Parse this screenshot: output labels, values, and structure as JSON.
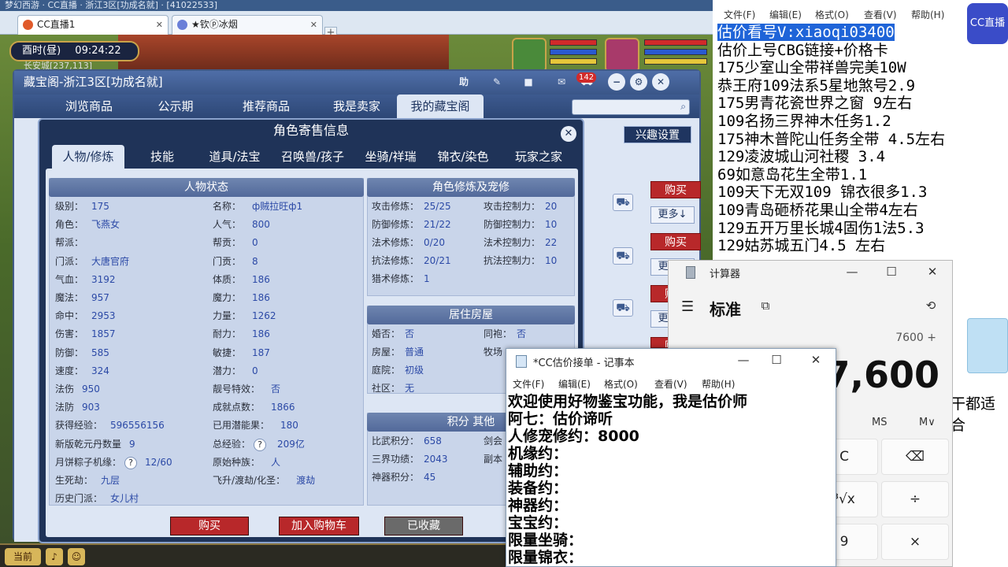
{
  "browser": {
    "tabs": [
      {
        "label": "CC直播1"
      },
      {
        "label": "★钦ⓟ冰烟"
      }
    ]
  },
  "game": {
    "clock_period": "酉时(昼)",
    "clock_time": "09:24:22",
    "location": "长安城[237,113]",
    "bottom_left": "当前"
  },
  "cbg": {
    "title": "藏宝阁-浙江3区[功成名就]",
    "help_label": "助",
    "cart_count": "142",
    "nav": [
      "浏览商品",
      "公示期",
      "推荐商品",
      "我是卖家",
      "我的藏宝阁"
    ],
    "interest_label": "兴趣设置",
    "buy_label": "购买",
    "more_label": "更多↓"
  },
  "dialog": {
    "title": "角色寄售信息",
    "tabs": [
      "人物/修炼",
      "技能",
      "道具/法宝",
      "召唤兽/孩子",
      "坐骑/祥瑞",
      "锦衣/染色",
      "玩家之家"
    ],
    "sections": {
      "person": "人物状态",
      "cultivation": "角色修炼及宠修",
      "house": "居住房屋",
      "points": "积分 其他"
    },
    "person_left": [
      {
        "label": "级别：",
        "value": "175"
      },
      {
        "label": "角色：",
        "value": "飞燕女"
      },
      {
        "label": "帮派：",
        "value": ""
      },
      {
        "label": "门派：",
        "value": "大唐官府"
      },
      {
        "label": "气血：",
        "value": "3192"
      },
      {
        "label": "魔法：",
        "value": "957"
      },
      {
        "label": "命中：",
        "value": "2953"
      },
      {
        "label": "伤害：",
        "value": "1857"
      },
      {
        "label": "防御：",
        "value": "585"
      },
      {
        "label": "速度：",
        "value": "324"
      },
      {
        "label": "法伤",
        "value": "950"
      },
      {
        "label": "法防",
        "value": "903"
      },
      {
        "label": "获得经验：",
        "value": "596556156"
      },
      {
        "label": "新版乾元丹数量",
        "value": "9"
      },
      {
        "label": "月饼粽子机缘：",
        "value": "12/60"
      },
      {
        "label": "生死劫：",
        "value": "九层"
      },
      {
        "label": "历史门派：",
        "value": "女儿村"
      }
    ],
    "person_right": [
      {
        "label": "名称：",
        "value": "ф贼拉旺ф1"
      },
      {
        "label": "人气：",
        "value": "800"
      },
      {
        "label": "帮贡：",
        "value": "0"
      },
      {
        "label": "门贡：",
        "value": "8"
      },
      {
        "label": "体质：",
        "value": "186"
      },
      {
        "label": "魔力：",
        "value": "186"
      },
      {
        "label": "力量：",
        "value": "1262"
      },
      {
        "label": "耐力：",
        "value": "186"
      },
      {
        "label": "敏捷：",
        "value": "187"
      },
      {
        "label": "潜力：",
        "value": "0"
      },
      {
        "label": "靓号特效：",
        "value": "否"
      },
      {
        "label": "成就点数：",
        "value": "1866"
      },
      {
        "label": "已用潜能果：",
        "value": "180"
      },
      {
        "label": "总经验：",
        "value": "209亿"
      },
      {
        "label": "原始种族：",
        "value": "人"
      },
      {
        "label": "飞升/渡劫/化圣：",
        "value": "渡劫"
      }
    ],
    "cultivation": [
      {
        "label": "攻击修炼：",
        "value": "25/25",
        "label2": "攻击控制力：",
        "value2": "20"
      },
      {
        "label": "防御修炼：",
        "value": "21/22",
        "label2": "防御控制力：",
        "value2": "10"
      },
      {
        "label": "法术修炼：",
        "value": "0/20",
        "label2": "法术控制力：",
        "value2": "22"
      },
      {
        "label": "抗法修炼：",
        "value": "20/21",
        "label2": "抗法控制力：",
        "value2": "10"
      },
      {
        "label": "猎术修炼：",
        "value": "1",
        "label2": "",
        "value2": ""
      }
    ],
    "house": [
      {
        "label": "婚否：",
        "value": "否",
        "label2": "同袍：",
        "value2": "否"
      },
      {
        "label": "房屋：",
        "value": "普通",
        "label2": "牧场",
        "value2": ""
      },
      {
        "label": "庭院：",
        "value": "初级",
        "label2": "",
        "value2": ""
      },
      {
        "label": "社区：",
        "value": "无",
        "label2": "",
        "value2": ""
      }
    ],
    "points": [
      {
        "label": "比武积分：",
        "value": "658",
        "label2": "剑会",
        "value2": ""
      },
      {
        "label": "三界功绩：",
        "value": "2043",
        "label2": "副本",
        "value2": ""
      },
      {
        "label": "神器积分：",
        "value": "45",
        "label2": "",
        "value2": ""
      }
    ],
    "buttons": {
      "buy": "购买",
      "add_cart": "加入购物车",
      "favorited": "已收藏"
    }
  },
  "overlay": {
    "menu": [
      "文件(F)",
      "编辑(E)",
      "格式(O)",
      "查看(V)",
      "帮助(H)"
    ],
    "lines": [
      "估价看号V:xiaoqi03400",
      "估价上号CBG链接+价格卡",
      "175少室山全带祥兽完美10W",
      "恭王府109法系5星地煞号2.9",
      "175男青花瓷世界之窗  9左右",
      "109名扬三界神木任务1.2",
      "175神木普陀山任务全带 4.5左右",
      "129凌波城山河社稷  3.4",
      "69如意岛花生全带1.1",
      "109天下无双109  锦衣很多1.3",
      "109青岛砸桥花果山全带4左右",
      "129五开万里长城4固伤1法5.3",
      "129姑苏城五门4.5 左右"
    ],
    "side_text": "干都适合",
    "logo_text": "CC直播"
  },
  "calculator": {
    "title": "计算器",
    "mode": "标准",
    "expression": "7600 +",
    "display": "7,600",
    "mem_ms": "MS",
    "mem_mv": "M∨",
    "keys": [
      "C",
      "⌫",
      "³√x",
      "÷",
      "9",
      "×"
    ]
  },
  "notepad": {
    "title": "*CC估价接单 - 记事本",
    "menu": [
      "文件(F)",
      "编辑(E)",
      "格式(O)",
      "查看(V)",
      "帮助(H)"
    ],
    "lines": [
      "欢迎使用好物鉴宝功能，我是估价师",
      "阿七：估价谛听",
      "人修宠修约：8000",
      "机缘约：",
      "辅助约：",
      "装备约：",
      "神器约：",
      "宝宝约：",
      "限量坐骑：",
      "限量锦衣："
    ]
  }
}
